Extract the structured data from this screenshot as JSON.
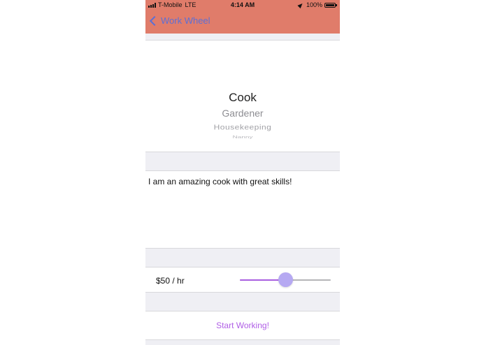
{
  "status_bar": {
    "carrier": "T-Mobile",
    "network": "LTE",
    "time": "4:14 AM",
    "battery": "100%"
  },
  "nav": {
    "back_label": "Work Wheel",
    "color": "#e07c6a",
    "tint": "#5b6fd6"
  },
  "picker": {
    "options": [
      "Cook",
      "Gardener",
      "Housekeeping",
      "Nanny"
    ],
    "selected": "Cook"
  },
  "description": {
    "value": "I am an amazing cook with great skills!"
  },
  "rate": {
    "label": "$50 / hr",
    "slider_value": 0.5,
    "accent": "#a95ee0"
  },
  "action": {
    "label": "Start Working!",
    "color": "#b05ee6"
  }
}
